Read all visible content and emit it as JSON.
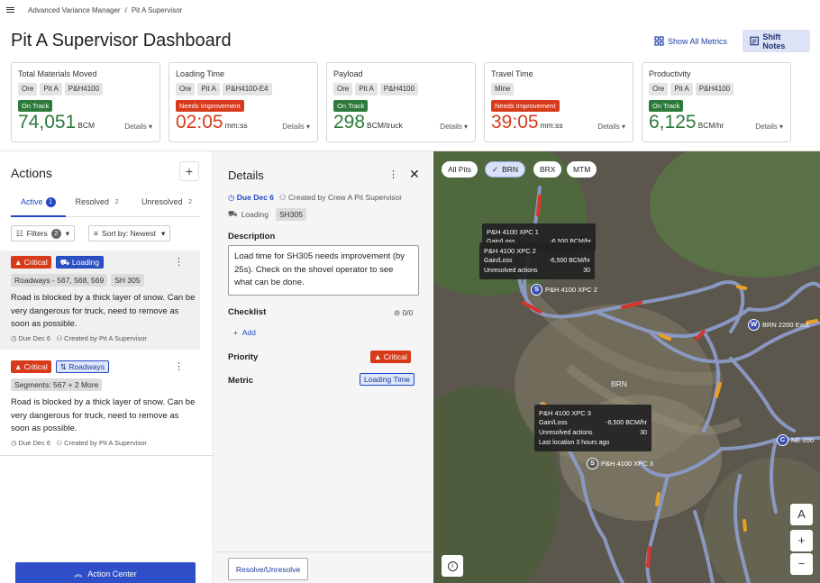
{
  "breadcrumb": {
    "root": "Advanced Variance Manager",
    "separator": "/",
    "current": "Pit A Supervisor"
  },
  "page_title": "Pit A Supervisor Dashboard",
  "header_buttons": {
    "metrics": "Show All Metrics",
    "notes": "Shift Notes"
  },
  "kpis": [
    {
      "title": "Total Materials Moved",
      "tags": [
        "Ore",
        "Pit A",
        "P&H4100"
      ],
      "status": "On Track",
      "status_type": "ok",
      "value": "74,051",
      "unit": "BCM",
      "details": "Details"
    },
    {
      "title": "Loading Time",
      "tags": [
        "Ore",
        "Pit A",
        "P&H4100-E4"
      ],
      "status": "Needs Improvement",
      "status_type": "bad",
      "value": "02:05",
      "unit": "mm:ss",
      "details": "Details"
    },
    {
      "title": "Payload",
      "tags": [
        "Ore",
        "Pit A",
        "P&H4100"
      ],
      "status": "On Track",
      "status_type": "ok",
      "value": "298",
      "unit": "BCM/truck",
      "details": "Details"
    },
    {
      "title": "Travel Time",
      "tags": [
        "Mine"
      ],
      "status": "Needs Improvement",
      "status_type": "bad",
      "value": "39:05",
      "unit": "mm:ss",
      "details": "Details"
    },
    {
      "title": "Productivity",
      "tags": [
        "Ore",
        "Pit A",
        "P&H4100"
      ],
      "status": "On Track",
      "status_type": "ok",
      "value": "6,125",
      "unit": "BCM/hr",
      "details": "Details"
    }
  ],
  "actions": {
    "title": "Actions",
    "add": "+",
    "tabs": [
      {
        "label": "Active",
        "count": "1"
      },
      {
        "label": "Resolved",
        "count": "2"
      },
      {
        "label": "Unresolved",
        "count": "2"
      }
    ],
    "filters_label": "Filters",
    "filters_count": "2",
    "sort_label": "Sort by: Newest",
    "items": [
      {
        "priority": "Critical",
        "type": "Loading",
        "segments": [
          "Roadways - 567, 568, 569",
          "SH 305"
        ],
        "description": "Road is blocked by a thick layer of snow. Can be very dangerous for truck, need to remove as soon as possible.",
        "due": "Due Dec 6",
        "created": "Created by Pit A Supervisor"
      },
      {
        "priority": "Critical",
        "type": "Roadways",
        "segments": [
          "Segments: 567 + 2 More"
        ],
        "description": "Road is blocked by a thick layer of snow. Can be very dangerous for truck, need to remove as soon as possible.",
        "due": "Due Dec 6",
        "created": "Created by Pit A Supervisor"
      }
    ],
    "action_center": "Action Center"
  },
  "details": {
    "title": "Details",
    "due": "Due Dec 6",
    "created": "Created by Crew A Pit Supervisor",
    "category": "Loading",
    "tag": "SH305",
    "description_label": "Description",
    "description": "Load time for SH305 needs improvement (by 25s). Check on the shovel operator to see what can be done.",
    "checklist_label": "Checklist",
    "checklist_count": "0/0",
    "add_label": "Add",
    "priority_label": "Priority",
    "priority_value": "Critical",
    "metric_label": "Metric",
    "metric_value": "Loading Time",
    "resolve_button": "Resolve/Unresolve"
  },
  "map": {
    "chips": [
      {
        "label": "All Pits",
        "selected": false
      },
      {
        "label": "BRN",
        "selected": true
      },
      {
        "label": "BRX",
        "selected": false
      },
      {
        "label": "MTM",
        "selected": false
      }
    ],
    "tooltips": [
      {
        "title": "P&H 4100 XPC 1",
        "rows": [
          [
            "Gain/Loss",
            "-6,500 BCM/hr"
          ]
        ]
      },
      {
        "title": "P&H 4100 XPC 2",
        "rows": [
          [
            "Gain/Loss",
            "-6,500 BCM/hr"
          ],
          [
            "Unresolved actions",
            "30"
          ]
        ]
      },
      {
        "title": "P&H 4100 XPC 3",
        "rows": [
          [
            "Gain/Loss",
            "-6,500 BCM/hr"
          ],
          [
            "Unresolved actions",
            "30"
          ],
          [
            "Last location 3 hours ago",
            ""
          ]
        ]
      }
    ],
    "markers": [
      {
        "letter": "S",
        "label": "P&H 4100 XPC 2",
        "color": "#3a4fb0"
      },
      {
        "letter": "W",
        "label": "BRN 2200 East",
        "color": "#3a4fb0"
      },
      {
        "letter": "C",
        "label": "NE 200",
        "color": "#3a4fb0"
      },
      {
        "letter": "S",
        "label": "P&H 4100 XPC 3",
        "color": "#3a4fb0"
      }
    ],
    "area_label": "BRN",
    "controls": {
      "north": "A",
      "zoom_in": "+",
      "zoom_out": "−",
      "info": "i"
    }
  }
}
